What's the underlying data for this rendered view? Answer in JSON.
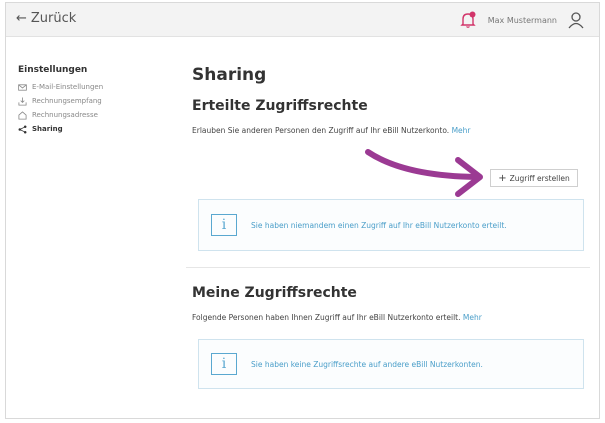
{
  "topbar": {
    "back_label": "Zurück",
    "user_name": "Max Mustermann"
  },
  "sidebar": {
    "title": "Einstellungen",
    "items": [
      {
        "label": "E-Mail-Einstellungen",
        "icon": "mail-icon"
      },
      {
        "label": "Rechnungsempfang",
        "icon": "receive-icon"
      },
      {
        "label": "Rechnungsadresse",
        "icon": "home-icon"
      },
      {
        "label": "Sharing",
        "icon": "share-icon",
        "active": true
      }
    ]
  },
  "main": {
    "page_title": "Sharing",
    "granted": {
      "title": "Erteilte Zugriffsrechte",
      "description": "Erlauben Sie anderen Personen den Zugriff auf Ihr eBill Nutzerkonto.",
      "more_link": "Mehr",
      "add_button": "Zugriff erstellen",
      "info_text": "Sie haben niemandem einen Zugriff auf Ihr eBill Nutzerkonto erteilt."
    },
    "received": {
      "title": "Meine Zugriffsrechte",
      "description": "Folgende Personen haben Ihnen Zugriff auf Ihr eBill Nutzerkonto erteilt.",
      "more_link": "Mehr",
      "info_text": "Sie haben keine Zugriffsrechte auf andere eBill Nutzerkonten."
    }
  },
  "colors": {
    "accent": "#4a9ec9",
    "annotation_arrow": "#9b3a93"
  }
}
